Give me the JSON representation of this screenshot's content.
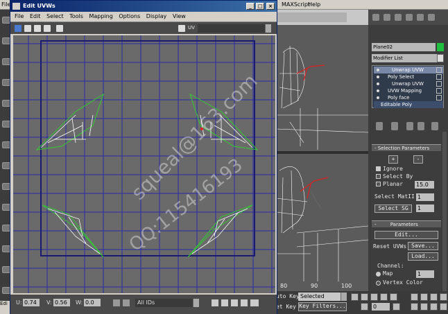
{
  "max_menu": {
    "file": "File",
    "maxscript": "MAXScript",
    "help": "Help"
  },
  "edit_uvws": {
    "title": "Edit UVWs",
    "title_buttons": [
      "_",
      "□",
      "×"
    ],
    "menu": [
      "File",
      "Edit",
      "Select",
      "Tools",
      "Mapping",
      "Options",
      "Display",
      "View"
    ],
    "uv_label": "UV",
    "bottom": {
      "u_label": "U:",
      "u_value": "0.74",
      "v_label": "V:",
      "v_value": "0.56",
      "w_label": "W:",
      "w_value": "0.0",
      "filter_value": "All IDs"
    }
  },
  "watermark": {
    "line1": "squeal@163.com",
    "line2": "QQ:115416193"
  },
  "command_panel": {
    "object_name": "Plane02",
    "modifier_list": "Modifier List",
    "stack": [
      "Unwrap UVW",
      "Poly Select",
      "Unwrap UVW",
      "UVW Mapping",
      "Poly face",
      "Editable Poly"
    ],
    "selection_parameters": "Selection Parameters",
    "plus": "+",
    "minus": "-",
    "ignore": "Ignore",
    "select_by": "Select By",
    "planar": "Planar",
    "planar_value": "15.0",
    "select_mat_id": "Select MatII",
    "mat_id_value": "1",
    "select_sg": "Select SG",
    "sg_value": "1",
    "parameters": "Parameters",
    "edit": "Edit...",
    "reset_uvws": "Reset UVWs",
    "save": "Save...",
    "load": "Load...",
    "channel": "Channel:",
    "map": "Map",
    "map_value": "1",
    "vertex_color": "Vertex Color"
  },
  "timeline": {
    "t80": "80",
    "t90": "90",
    "t100": "100"
  },
  "status": {
    "auto_key": "uto Key",
    "selected": "Selected",
    "set_key": "et Key",
    "key_filters": "Key Filters...",
    "frame": "0"
  },
  "edit_label": "Edi",
  "colors": {
    "uv_grid": "#2a2aa8",
    "uv_bg": "#6a6a6a",
    "uv_green": "#33cc33",
    "uv_white": "#ffffff",
    "title_blue": "#0a246a",
    "mesh_red": "#e02020"
  }
}
